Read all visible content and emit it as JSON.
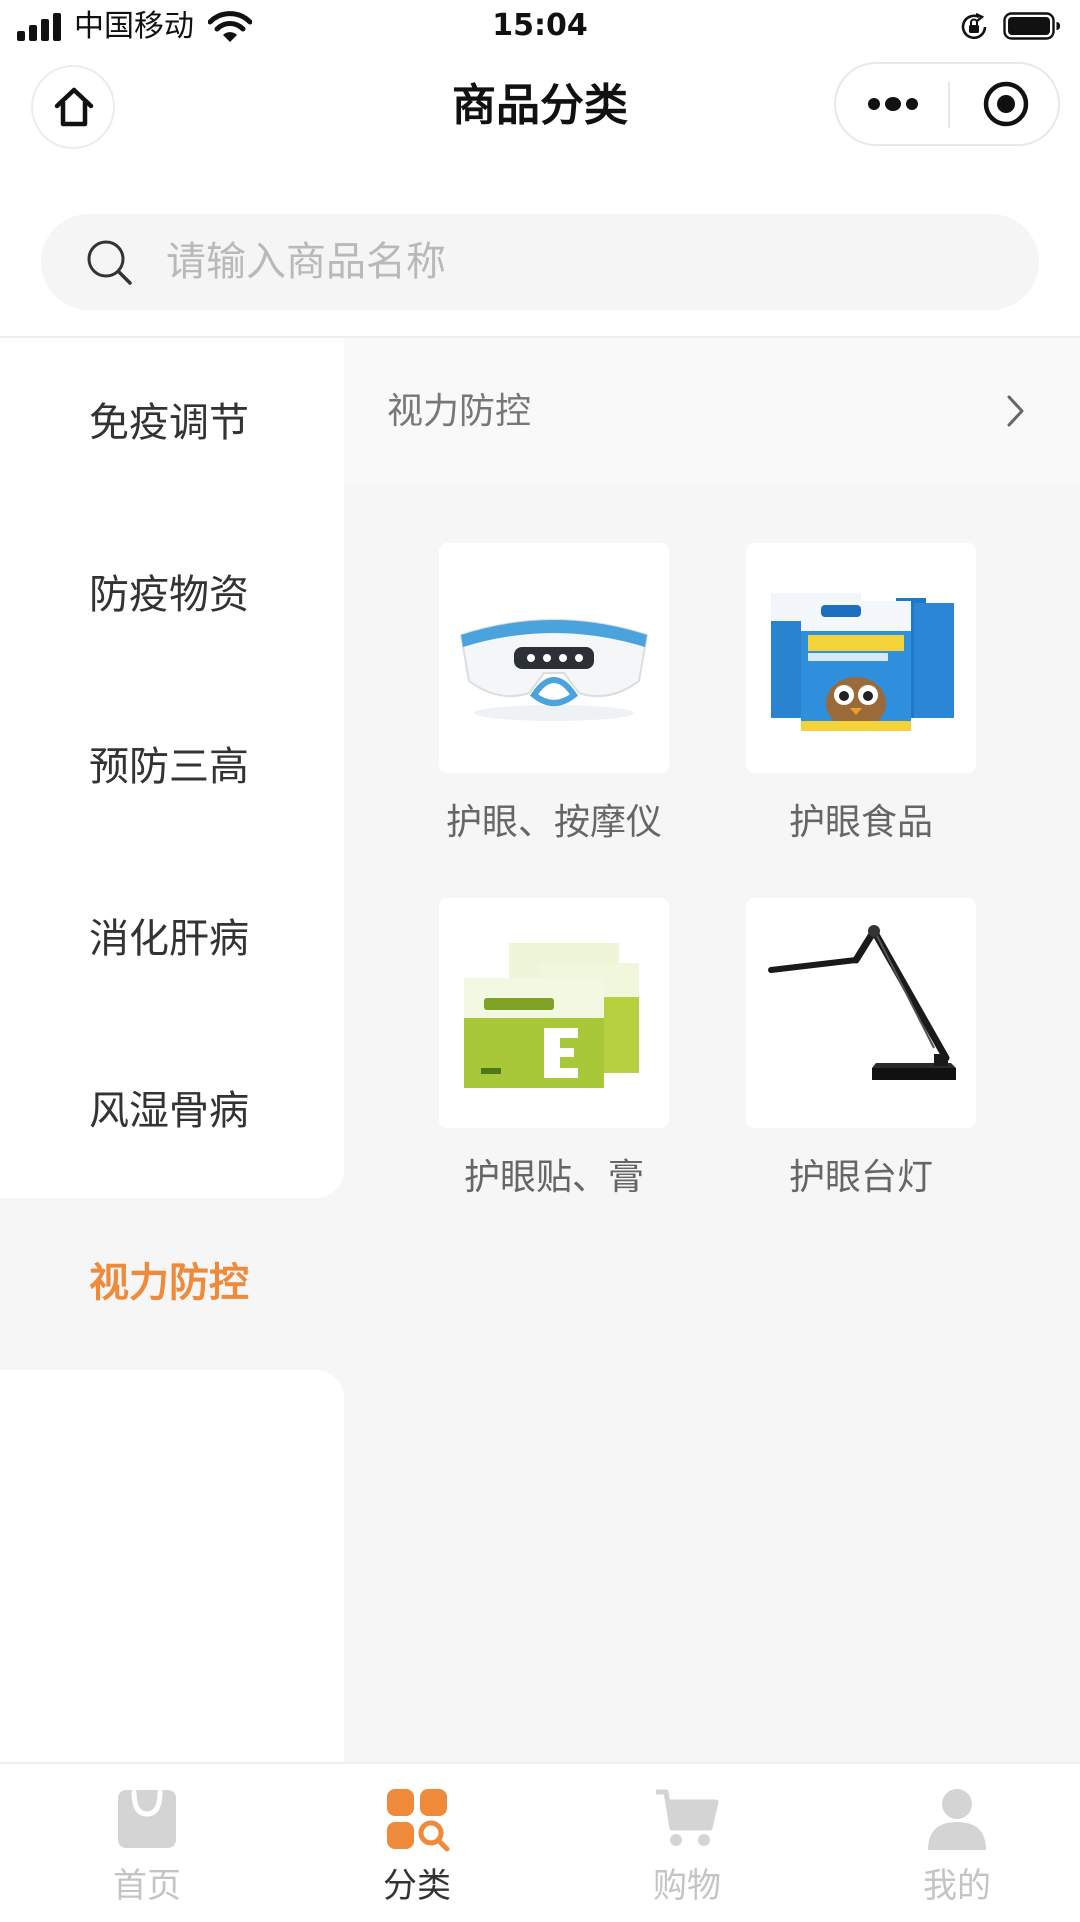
{
  "status_bar": {
    "carrier": "中国移动",
    "time": "15:04"
  },
  "nav": {
    "title": "商品分类",
    "home_icon": "home-icon",
    "more_icon": "more-dots-icon",
    "close_icon": "target-icon"
  },
  "search": {
    "placeholder": "请输入商品名称",
    "icon": "search-icon"
  },
  "sidebar": {
    "items": [
      {
        "label": "免疫调节"
      },
      {
        "label": "防疫物资"
      },
      {
        "label": "预防三高"
      },
      {
        "label": "消化肝病"
      },
      {
        "label": "风湿骨病"
      },
      {
        "label": "视力防控",
        "active": true
      }
    ]
  },
  "content": {
    "header_title": "视力防控",
    "products": [
      {
        "label": "护眼、按摩仪",
        "image": "eye-massager-image"
      },
      {
        "label": "护眼食品",
        "image": "eye-food-box-image"
      },
      {
        "label": "护眼贴、膏",
        "image": "eye-patch-image"
      },
      {
        "label": "护眼台灯",
        "image": "desk-lamp-image"
      }
    ]
  },
  "tabbar": {
    "tabs": [
      {
        "label": "首页",
        "icon": "bag-icon"
      },
      {
        "label": "分类",
        "icon": "category-icon",
        "active": true
      },
      {
        "label": "购物",
        "icon": "cart-icon"
      },
      {
        "label": "我的",
        "icon": "person-icon"
      }
    ]
  },
  "colors": {
    "accent": "#ee8a3a",
    "inactive_tab": "#c4c4c4",
    "panel_bg": "#f6f6f6"
  }
}
